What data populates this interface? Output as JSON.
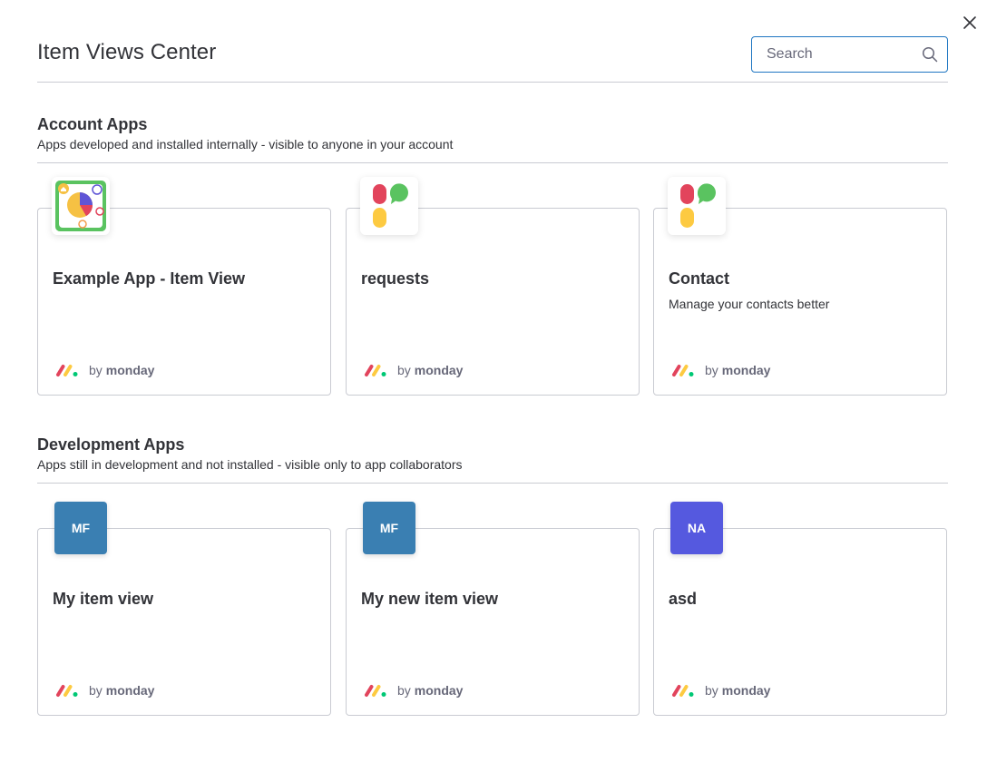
{
  "page": {
    "title": "Item Views Center",
    "search_placeholder": "Search"
  },
  "icons": {
    "close": "close-icon",
    "search": "search-icon",
    "monday_logo": "monday-logo-icon"
  },
  "colors": {
    "search_border": "#1f76c2",
    "initials_mf": "#3a7fb2",
    "initials_na": "#5559df",
    "logo_red": "#e2445c",
    "logo_yellow": "#fdca41",
    "logo_green": "#00c875"
  },
  "sections": [
    {
      "title": "Account Apps",
      "description": "Apps developed and installed internally - visible to anyone in your account",
      "cards": [
        {
          "title": "Example App - Item View",
          "description": "",
          "by_prefix": "by",
          "by_name": "monday",
          "icon": "example-app-pie-icon"
        },
        {
          "title": "requests",
          "description": "",
          "by_prefix": "by",
          "by_name": "monday",
          "icon": "bubbles-logo-icon"
        },
        {
          "title": "Contact",
          "description": "Manage your contacts better",
          "by_prefix": "by",
          "by_name": "monday",
          "icon": "bubbles-logo-icon"
        }
      ]
    },
    {
      "title": "Development Apps",
      "description": "Apps still in development and not installed - visible only to app collaborators",
      "cards": [
        {
          "title": "My item view",
          "description": "",
          "by_prefix": "by",
          "by_name": "monday",
          "initials": "MF"
        },
        {
          "title": "My new item view",
          "description": "",
          "by_prefix": "by",
          "by_name": "monday",
          "initials": "MF"
        },
        {
          "title": "asd",
          "description": "",
          "by_prefix": "by",
          "by_name": "monday",
          "initials": "NA"
        }
      ]
    }
  ]
}
